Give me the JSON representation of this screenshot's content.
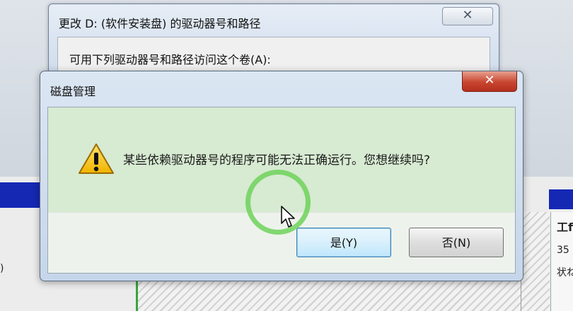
{
  "background": {
    "left_label": ")",
    "right_panel": {
      "line1": "工f",
      "line2": "35",
      "line3": "状ね"
    }
  },
  "back_window": {
    "title": "更改 D: (软件安装盘) 的驱动器号和路径",
    "close_glyph": "✕",
    "label": "可用下列驱动器号和路径访问这个卷(A):"
  },
  "dialog": {
    "title": "磁盘管理",
    "close_glyph": "✕",
    "message": "某些依赖驱动器号的程序可能无法正确运行。您想继续吗?",
    "icon": "warning-icon",
    "buttons": {
      "yes": "是(Y)",
      "no": "否(N)"
    }
  },
  "colors": {
    "accent_ring": "#6ed25a",
    "close_red": "#c8452f",
    "message_bg": "#d7ead2",
    "blue_bar": "#1428b4"
  }
}
